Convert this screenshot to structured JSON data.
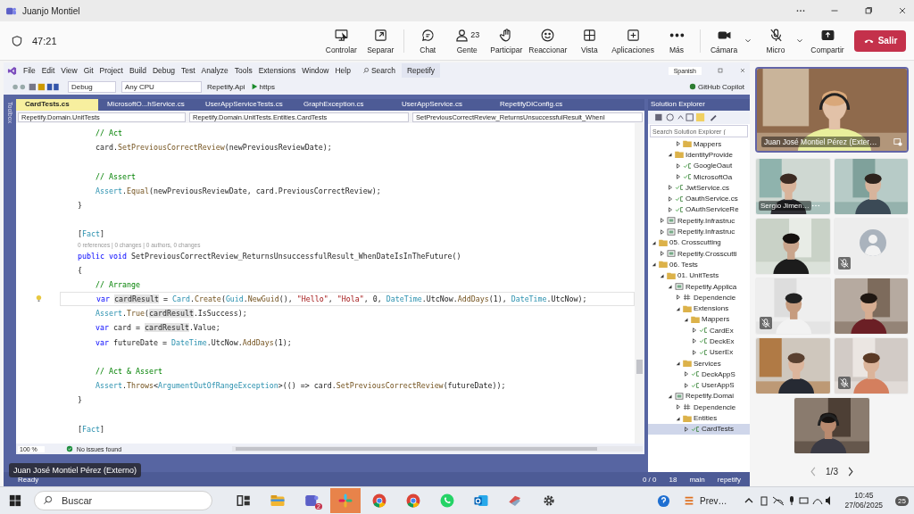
{
  "teams": {
    "title": "Juanjo Montiel",
    "timer": "47:21",
    "actions": [
      {
        "label": "Controlar",
        "kind": "control"
      },
      {
        "label": "Separar",
        "kind": "popout"
      },
      {
        "label": "Chat",
        "kind": "chat"
      },
      {
        "label": "Gente",
        "kind": "people",
        "count": "23"
      },
      {
        "label": "Participar",
        "kind": "hand"
      },
      {
        "label": "Reaccionar",
        "kind": "react"
      },
      {
        "label": "Vista",
        "kind": "view"
      },
      {
        "label": "Aplicaciones",
        "kind": "apps"
      },
      {
        "label": "Más",
        "kind": "more"
      },
      {
        "label": "Cámara",
        "kind": "camera",
        "off": false
      },
      {
        "label": "Micro",
        "kind": "mic",
        "off": true
      },
      {
        "label": "Compartir",
        "kind": "share"
      }
    ],
    "leave": "Salir"
  },
  "vs": {
    "menu": [
      "File",
      "Edit",
      "View",
      "Git",
      "Project",
      "Build",
      "Debug",
      "Test",
      "Analyze",
      "Tools",
      "Extensions",
      "Window",
      "Help"
    ],
    "search": "Search",
    "title": "Repetify",
    "keyboard": "Spanish",
    "toolbar": {
      "config": "Debug",
      "platform": "Any CPU",
      "startup": "Repetify.Api",
      "profile": "https",
      "copilot": "GitHub Copilot"
    },
    "toolbox": "Toolbox",
    "tabs": [
      {
        "label": "CardTests.cs",
        "selected": true
      },
      {
        "label": "MicrosoftO...hService.cs",
        "selected": false
      },
      {
        "label": "UserAppServiceTests.cs",
        "selected": false
      },
      {
        "label": "GraphException.cs",
        "selected": false
      },
      {
        "label": "UserAppService.cs",
        "selected": false
      },
      {
        "label": "RepetifyDiConfig.cs",
        "selected": false
      }
    ],
    "nav": [
      "Repetify.Domain.UnitTests",
      "Repetify.Domain.UnitTests.Entities.CardTests",
      "SetPreviousCorrectReview_ReturnsUnsuccessfulResult_WhenI"
    ],
    "code": [
      {
        "current": false,
        "tokens": [
          {
            "text": "        // Act",
            "kind": "comment"
          }
        ]
      },
      {
        "current": false,
        "tokens": [
          {
            "text": "        card.",
            "kind": "plain"
          },
          {
            "text": "SetPreviousCorrectReview",
            "kind": "method"
          },
          {
            "text": "(newPreviousReviewDate);",
            "kind": "plain"
          }
        ]
      },
      {
        "current": false,
        "space_before": true,
        "tokens": [
          {
            "text": "        // Assert",
            "kind": "comment"
          }
        ]
      },
      {
        "current": false,
        "tokens": [
          {
            "text": "        Assert",
            "kind": "type"
          },
          {
            "text": ".",
            "kind": "plain"
          },
          {
            "text": "Equal",
            "kind": "method"
          },
          {
            "text": "(newPreviousReviewDate, card.PreviousCorrectReview);",
            "kind": "plain"
          }
        ]
      },
      {
        "current": false,
        "tokens": [
          {
            "text": "    }",
            "kind": "plain"
          }
        ]
      },
      {
        "current": false,
        "space_before": true,
        "tokens": [
          {
            "text": "    [",
            "kind": "plain"
          },
          {
            "text": "Fact",
            "kind": "type"
          },
          {
            "text": "]",
            "kind": "plain"
          }
        ]
      },
      {
        "current": false,
        "lens": "0 references | 0 changes | 0 authors, 0 changes",
        "tokens": [
          {
            "text": "    public void ",
            "kind": "keyword"
          },
          {
            "text": "SetPreviousCorrectReview_ReturnsUnsuccessfulResult_WhenDateIsInTheFuture()",
            "kind": "plain"
          }
        ]
      },
      {
        "current": false,
        "tokens": [
          {
            "text": "    {",
            "kind": "plain"
          }
        ]
      },
      {
        "current": false,
        "tokens": [
          {
            "text": "        // Arrange",
            "kind": "comment"
          }
        ]
      },
      {
        "current": true,
        "lightbulb": true,
        "tokens": [
          {
            "text": "        var ",
            "kind": "keyword"
          },
          {
            "text": "cardResult",
            "kind": "reference"
          },
          {
            "text": " = ",
            "kind": "plain"
          },
          {
            "text": "Card",
            "kind": "type"
          },
          {
            "text": ".",
            "kind": "plain"
          },
          {
            "text": "Create",
            "kind": "method"
          },
          {
            "text": "(",
            "kind": "plain"
          },
          {
            "text": "Guid",
            "kind": "type"
          },
          {
            "text": ".",
            "kind": "plain"
          },
          {
            "text": "NewGuid",
            "kind": "method"
          },
          {
            "text": "(), ",
            "kind": "plain"
          },
          {
            "text": "\"Hello\"",
            "kind": "string"
          },
          {
            "text": ", ",
            "kind": "plain"
          },
          {
            "text": "\"Hola\"",
            "kind": "string"
          },
          {
            "text": ", 0, ",
            "kind": "plain"
          },
          {
            "text": "DateTime",
            "kind": "type"
          },
          {
            "text": ".UtcNow.",
            "kind": "plain"
          },
          {
            "text": "AddDays",
            "kind": "method"
          },
          {
            "text": "(1), ",
            "kind": "plain"
          },
          {
            "text": "DateTime",
            "kind": "type"
          },
          {
            "text": ".UtcNow);",
            "kind": "plain"
          }
        ]
      },
      {
        "current": false,
        "tokens": [
          {
            "text": "        Assert",
            "kind": "type"
          },
          {
            "text": ".",
            "kind": "plain"
          },
          {
            "text": "True",
            "kind": "method"
          },
          {
            "text": "(",
            "kind": "plain"
          },
          {
            "text": "cardResult",
            "kind": "reference"
          },
          {
            "text": ".IsSuccess);",
            "kind": "plain"
          }
        ]
      },
      {
        "current": false,
        "tokens": [
          {
            "text": "        var ",
            "kind": "keyword"
          },
          {
            "text": "card = ",
            "kind": "plain"
          },
          {
            "text": "cardResult",
            "kind": "reference"
          },
          {
            "text": ".Value;",
            "kind": "plain"
          }
        ]
      },
      {
        "current": false,
        "tokens": [
          {
            "text": "        var ",
            "kind": "keyword"
          },
          {
            "text": "futureDate = ",
            "kind": "plain"
          },
          {
            "text": "DateTime",
            "kind": "type"
          },
          {
            "text": ".UtcNow.",
            "kind": "plain"
          },
          {
            "text": "AddDays",
            "kind": "method"
          },
          {
            "text": "(1);",
            "kind": "plain"
          }
        ]
      },
      {
        "current": false,
        "space_before": true,
        "tokens": [
          {
            "text": "        // Act & Assert",
            "kind": "comment"
          }
        ]
      },
      {
        "current": false,
        "tokens": [
          {
            "text": "        Assert",
            "kind": "type"
          },
          {
            "text": ".",
            "kind": "plain"
          },
          {
            "text": "Throws",
            "kind": "method"
          },
          {
            "text": "<",
            "kind": "plain"
          },
          {
            "text": "ArgumentOutOfRangeException",
            "kind": "type"
          },
          {
            "text": ">(() => card.",
            "kind": "plain"
          },
          {
            "text": "SetPreviousCorrectReview",
            "kind": "method"
          },
          {
            "text": "(futureDate));",
            "kind": "plain"
          }
        ]
      },
      {
        "current": false,
        "tokens": [
          {
            "text": "    }",
            "kind": "plain"
          }
        ]
      },
      {
        "current": false,
        "space_before": true,
        "tokens": [
          {
            "text": "    [",
            "kind": "plain"
          },
          {
            "text": "Fact",
            "kind": "type"
          },
          {
            "text": "]",
            "kind": "plain"
          }
        ]
      }
    ],
    "editor_status": {
      "zoom": "100 %",
      "issues": "No issues found"
    },
    "status": {
      "ready": "Ready",
      "errors": "0 / 0",
      "edits": "18",
      "branch": "main",
      "repo": "repetify"
    },
    "solution_explorer": {
      "title": "Solution Explorer",
      "search_placeholder": "Search Solution Explorer (",
      "tree": [
        {
          "children": [
            {
              "children": [
                {
                  "children": [
                    {
                      "label": "Mappers",
                      "kind": "folder",
                      "expanded": false,
                      "selected": false
                    }
                  ]
                },
                {
                  "label": "IdentityProvide",
                  "kind": "folder",
                  "expanded": true,
                  "selected": false,
                  "children": [
                    {
                      "label": "GoogleOaut",
                      "kind": "cs",
                      "expanded": false,
                      "selected": false
                    },
                    {
                      "label": "MicrosoftOa",
                      "kind": "cs",
                      "expanded": false,
                      "selected": false
                    }
                  ]
                },
                {
                  "label": "JwtService.cs",
                  "kind": "cs",
                  "expanded": false,
                  "selected": false
                },
                {
                  "label": "OauthService.cs",
                  "kind": "cs",
                  "expanded": false,
                  "selected": false
                },
                {
                  "label": "OAuthServiceRe",
                  "kind": "cs",
                  "expanded": false,
                  "selected": false
                }
              ]
            },
            {
              "label": "Repetify.Infrastruc",
              "kind": "project",
              "expanded": false,
              "selected": false
            },
            {
              "label": "Repetify.Infrastruc",
              "kind": "project",
              "expanded": false,
              "selected": false
            }
          ]
        },
        {
          "label": "05. Crosscutting",
          "kind": "solution-folder",
          "expanded": true,
          "selected": false,
          "children": [
            {
              "label": "Repetify.Crosscutti",
              "kind": "project",
              "expanded": false,
              "selected": false
            }
          ]
        },
        {
          "label": "06. Tests",
          "kind": "solution-folder",
          "expanded": true,
          "selected": false,
          "children": [
            {
              "label": "01. UnitTests",
              "kind": "solution-folder",
              "expanded": true,
              "selected": false,
              "children": [
                {
                  "label": "Repetify.Applica",
                  "kind": "project",
                  "expanded": true,
                  "selected": false,
                  "children": [
                    {
                      "label": "Dependencie",
                      "kind": "deps",
                      "expanded": false,
                      "selected": false
                    },
                    {
                      "label": "Extensions",
                      "kind": "folder",
                      "expanded": true,
                      "selected": false,
                      "children": [
                        {
                          "label": "Mappers",
                          "kind": "folder",
                          "expanded": true,
                          "selected": false,
                          "children": [
                            {
                              "label": "CardEx",
                              "kind": "cs",
                              "expanded": false,
                              "selected": false
                            },
                            {
                              "label": "DeckEx",
                              "kind": "cs",
                              "expanded": false,
                              "selected": false
                            },
                            {
                              "label": "UserEx",
                              "kind": "cs",
                              "expanded": false,
                              "selected": false
                            }
                          ]
                        }
                      ]
                    },
                    {
                      "label": "Services",
                      "kind": "folder",
                      "expanded": true,
                      "selected": false,
                      "children": [
                        {
                          "label": "DeckAppS",
                          "kind": "cs",
                          "expanded": false,
                          "selected": false
                        },
                        {
                          "label": "UserAppS",
                          "kind": "cs",
                          "expanded": false,
                          "selected": false
                        }
                      ]
                    }
                  ]
                },
                {
                  "label": "Repetify.Domai",
                  "kind": "project",
                  "expanded": true,
                  "selected": false,
                  "children": [
                    {
                      "label": "Dependencie",
                      "kind": "deps",
                      "expanded": false,
                      "selected": false
                    },
                    {
                      "label": "Entities",
                      "kind": "folder",
                      "expanded": true,
                      "selected": false,
                      "children": [
                        {
                          "label": "CardTests",
                          "kind": "cs",
                          "expanded": false,
                          "selected": true
                        }
                      ]
                    }
                  ]
                }
              ]
            }
          ]
        }
      ]
    }
  },
  "presenter_label": "Juan José Montiel Pérez (Externo)",
  "video": {
    "main": {
      "name": "Juan José Montiel Pérez (Exter…",
      "speaking": true,
      "pinned": true
    },
    "tiles": [
      {
        "kind": "video",
        "name": "Sergio Jimen…",
        "options": true,
        "muted": false,
        "speaking": false
      },
      {
        "kind": "video",
        "options": false,
        "muted": false,
        "speaking": false
      },
      {
        "kind": "video",
        "options": false,
        "muted": false,
        "speaking": false
      },
      {
        "kind": "avatar",
        "options": false,
        "muted": true,
        "speaking": false
      },
      {
        "kind": "video",
        "options": false,
        "muted": true,
        "speaking": false
      },
      {
        "kind": "video",
        "options": false,
        "muted": false,
        "speaking": false
      },
      {
        "kind": "video",
        "options": false,
        "muted": false,
        "speaking": false
      },
      {
        "kind": "video",
        "options": false,
        "muted": true,
        "speaking": false
      },
      {
        "kind": "video",
        "options": false,
        "muted": false,
        "speaking": false
      }
    ],
    "pager": "1/3"
  },
  "taskbar": {
    "search_placeholder": "Buscar",
    "apps": [
      {
        "kind": "taskview",
        "selected": false
      },
      {
        "kind": "explorer",
        "selected": false
      },
      {
        "kind": "teams",
        "badge": "2",
        "selected": false
      },
      {
        "kind": "slack",
        "selected": true
      },
      {
        "kind": "chrome",
        "selected": false
      },
      {
        "kind": "chrome",
        "selected": false
      },
      {
        "kind": "whatsapp",
        "selected": false
      },
      {
        "kind": "outlook",
        "selected": false
      },
      {
        "kind": "app",
        "selected": false
      },
      {
        "kind": "settings",
        "selected": false
      }
    ],
    "weather": "Prev…",
    "time": "10:45",
    "date": "27/06/2025",
    "notifications": "25"
  }
}
